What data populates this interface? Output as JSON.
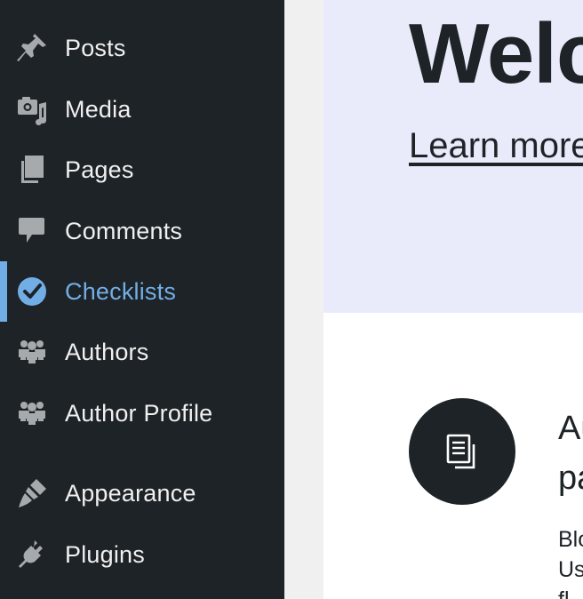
{
  "sidebar": {
    "items": [
      {
        "label": "Posts",
        "icon": "pushpin-icon"
      },
      {
        "label": "Media",
        "icon": "media-icon"
      },
      {
        "label": "Pages",
        "icon": "pages-icon"
      },
      {
        "label": "Comments",
        "icon": "comment-icon"
      },
      {
        "label": "Checklists",
        "icon": "checkmark-circle-icon",
        "current": true
      },
      {
        "label": "Authors",
        "icon": "groups-icon"
      },
      {
        "label": "Author Profile",
        "icon": "groups-icon"
      },
      {
        "label": "Appearance",
        "icon": "paintbrush-icon"
      },
      {
        "label": "Plugins",
        "icon": "plug-icon"
      }
    ]
  },
  "main": {
    "hero": {
      "title": "Welc",
      "link": "Learn more"
    },
    "card": {
      "icon": "document-icon",
      "title_line1": "Au",
      "title_line2": "pa",
      "text_line1": "Blo",
      "text_line2": "Us",
      "text_line3": "fl"
    }
  },
  "colors": {
    "sidebar_bg": "#1d2327",
    "sidebar_text": "#f0f0f1",
    "sidebar_icon": "#a7aaad",
    "current_accent": "#72aee6",
    "hero_bg": "#e9ebfa",
    "text_dark": "#1d2327"
  }
}
